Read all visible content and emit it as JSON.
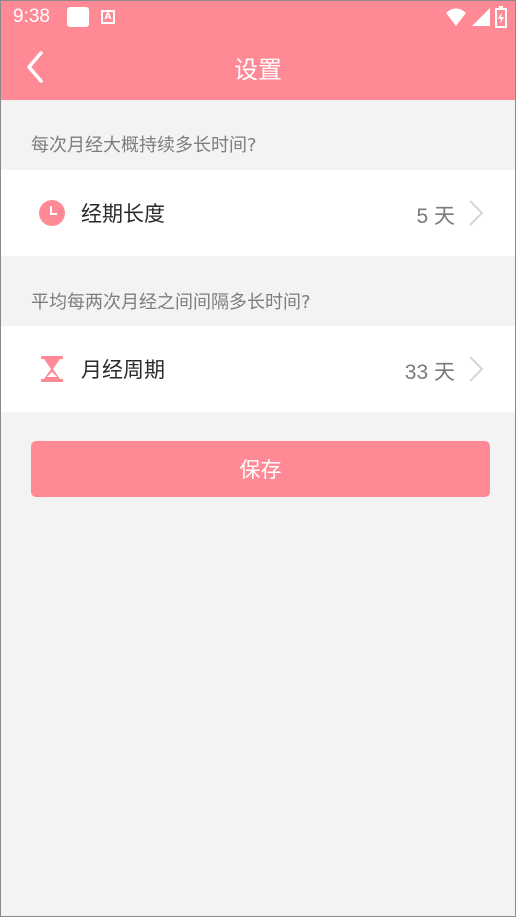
{
  "status_bar": {
    "time": "9:38",
    "a_label": "A"
  },
  "header": {
    "title": "设置"
  },
  "period": {
    "question": "每次月经大概持续多长时间?",
    "label": "经期长度",
    "value": "5 天"
  },
  "cycle": {
    "question": "平均每两次月经之间间隔多长时间?",
    "label": "月经周期",
    "value": "33 天"
  },
  "save_label": "保存",
  "colors": {
    "accent": "#ff8a96",
    "background": "#f3f3f3"
  },
  "icons": [
    "back-icon",
    "clock-icon",
    "hourglass-icon",
    "chevron-right-icon",
    "wifi-icon",
    "signal-icon",
    "battery-icon"
  ]
}
